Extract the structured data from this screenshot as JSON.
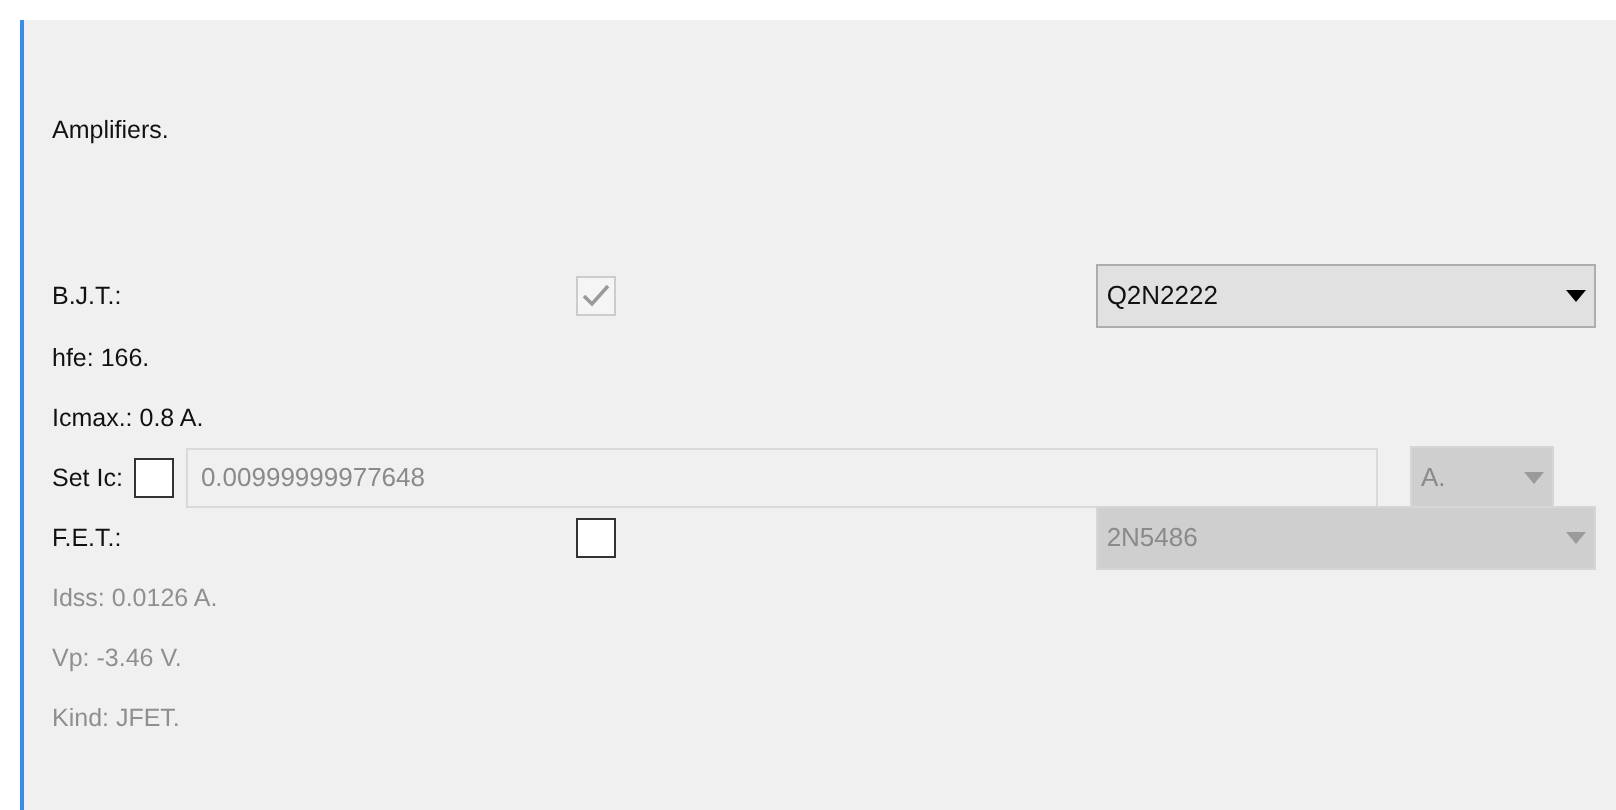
{
  "heading": "Amplifiers.",
  "bjt": {
    "label": "B.J.T.:",
    "checked": true,
    "disabled": true,
    "model": "Q2N2222",
    "model_disabled": false
  },
  "bjt_info": [
    {
      "text": "hfe: 166.",
      "disabled": false
    },
    {
      "text": "Icmax.: 0.8 A.",
      "disabled": false
    }
  ],
  "set_ic": {
    "label": "Set Ic:",
    "checked": false,
    "value": "0.00999999977648",
    "unit": "A.",
    "disabled": true
  },
  "fet": {
    "label": "F.E.T.:",
    "checked": false,
    "disabled": false,
    "model": "2N5486",
    "model_disabled": true
  },
  "fet_info": [
    {
      "text": "Idss: 0.0126 A.",
      "disabled": true
    },
    {
      "text": "Vp: -3.46 V.",
      "disabled": true
    },
    {
      "text": "Kind: JFET.",
      "disabled": true
    }
  ]
}
